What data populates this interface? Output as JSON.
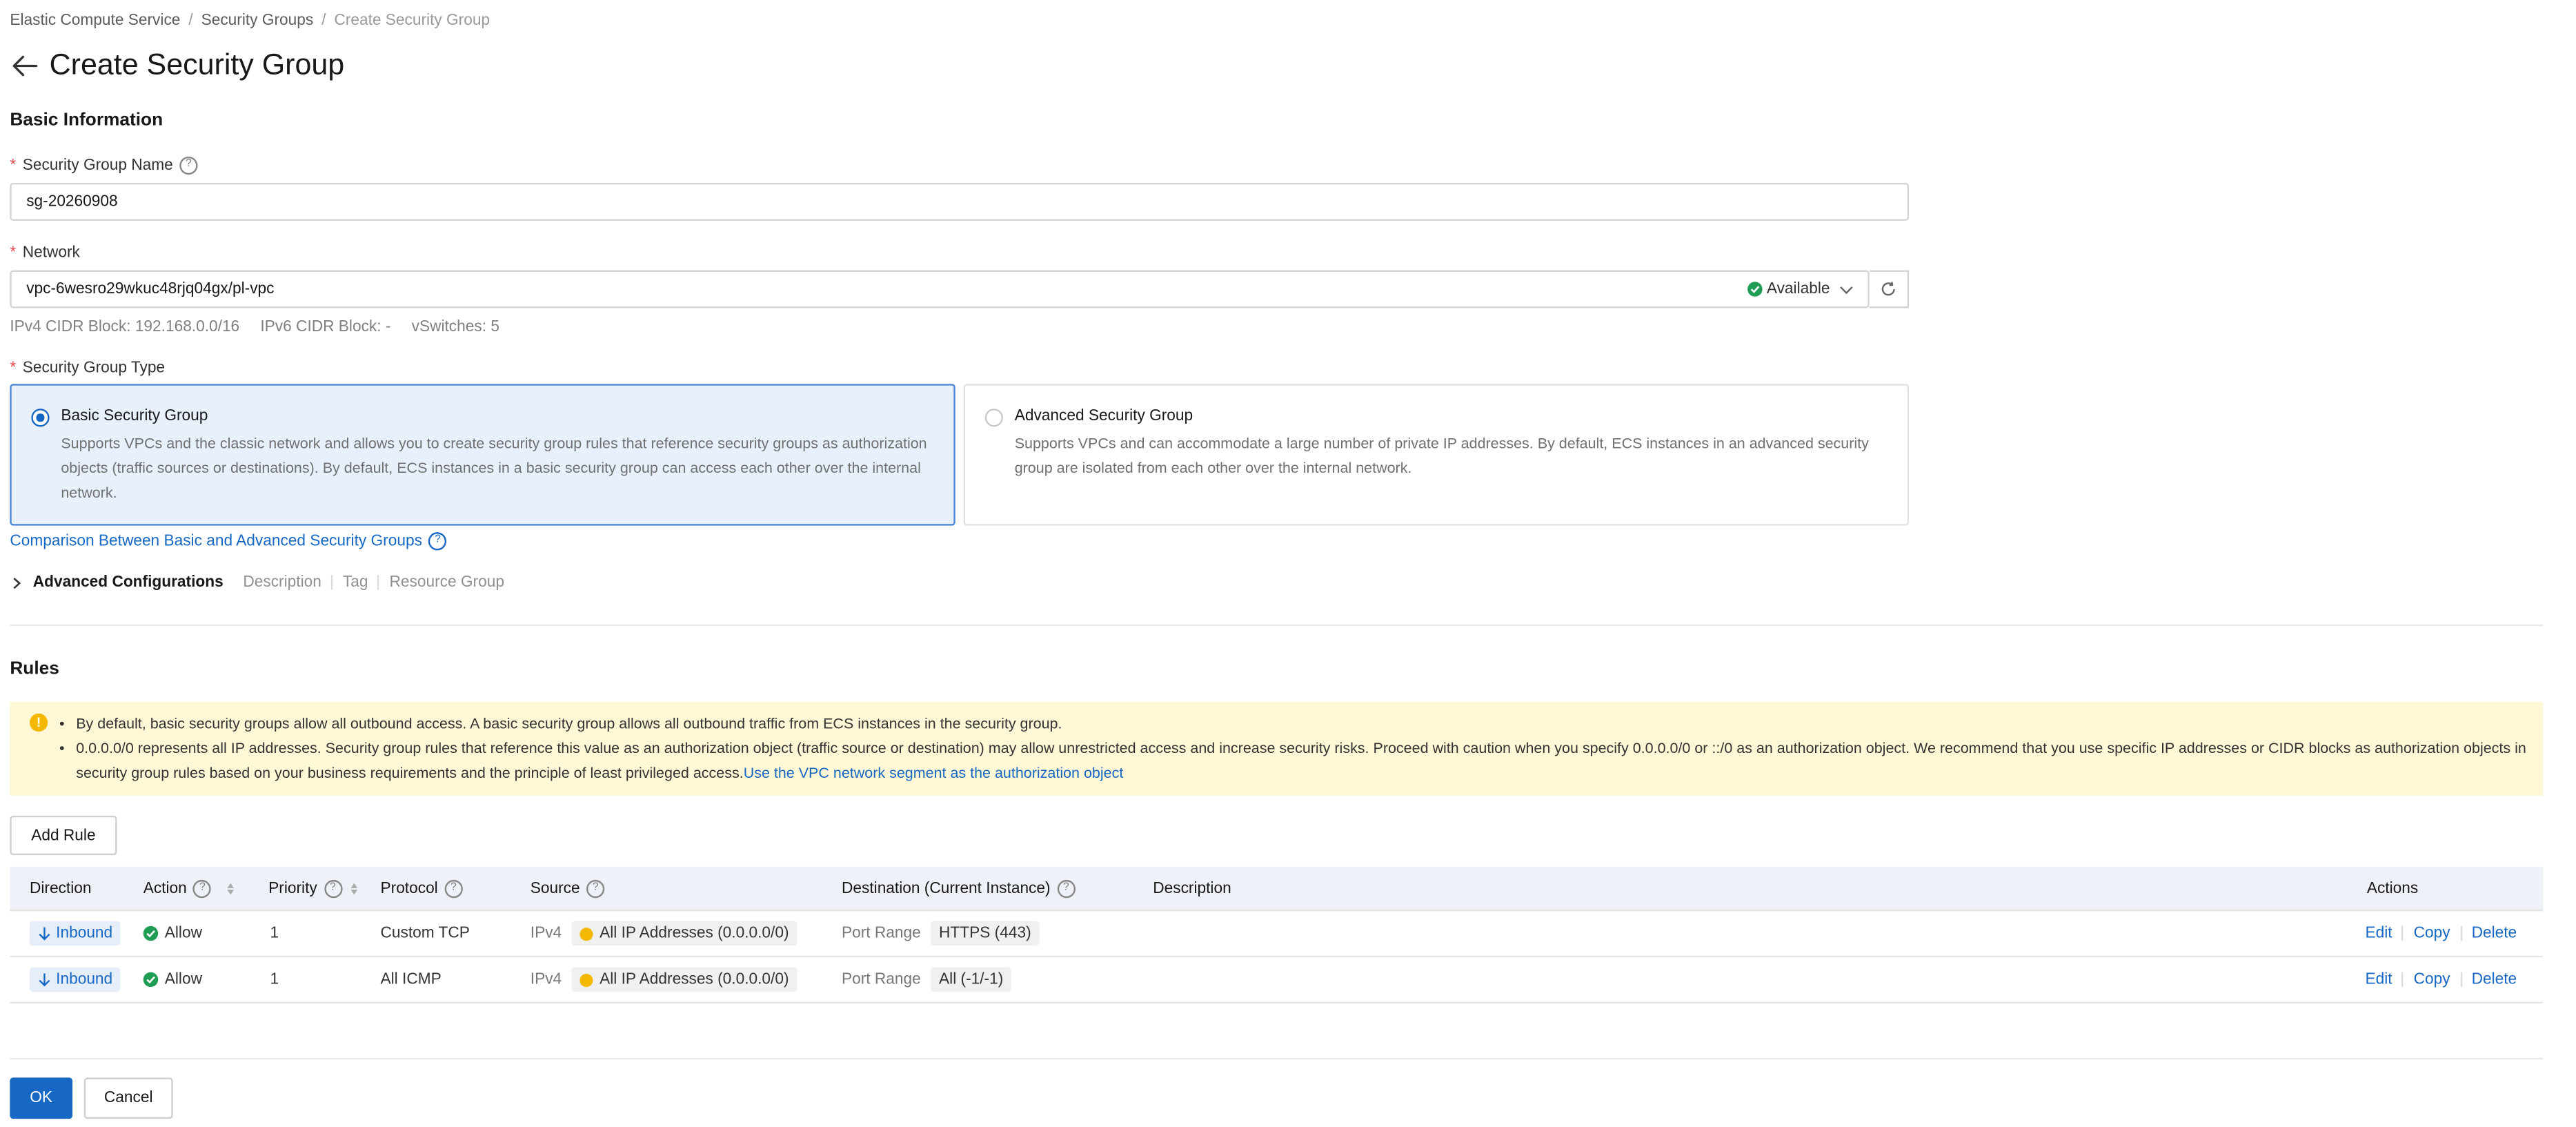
{
  "breadcrumb": {
    "items": [
      "Elastic Compute Service",
      "Security Groups"
    ],
    "separator": "/",
    "current": "Create Security Group"
  },
  "page": {
    "title": "Create Security Group"
  },
  "basic_info": {
    "title": "Basic Information",
    "name_label": "Security Group Name",
    "name_value": "sg-20260908",
    "network_label": "Network",
    "network_value": "vpc-6wesro29wkuc48rjq04gx/pl-vpc",
    "network_status": "Available",
    "ipv4": "IPv4 CIDR Block: 192.168.0.0/16",
    "ipv6": "IPv6 CIDR Block: -",
    "vswitches": "vSwitches: 5",
    "type_label": "Security Group Type",
    "types": [
      {
        "title": "Basic Security Group",
        "desc": "Supports VPCs and the classic network and allows you to create security group rules that reference security groups as authorization objects (traffic sources or destinations). By default, ECS instances in a basic security group can access each other over the internal network.",
        "selected": true
      },
      {
        "title": "Advanced Security Group",
        "desc": "Supports VPCs and can accommodate a large number of private IP addresses. By default, ECS instances in an advanced security group are isolated from each other over the internal network.",
        "selected": false
      }
    ],
    "comparison_link": "Comparison Between Basic and Advanced Security Groups"
  },
  "advanced": {
    "title": "Advanced Configurations",
    "items": [
      "Description",
      "Tag",
      "Resource Group"
    ]
  },
  "rules": {
    "title": "Rules",
    "alert": {
      "bullet1": "By default, basic security groups allow all outbound access. A basic security group allows all outbound traffic from ECS instances in the security group.",
      "bullet2": "0.0.0.0/0 represents all IP addresses. Security group rules that reference this value as an authorization object (traffic source or destination) may allow unrestricted access and increase security risks. Proceed with caution when you specify 0.0.0.0/0 or ::/0 as an authorization object. We recommend that you use specific IP addresses or CIDR blocks as authorization objects in security group rules based on your business requirements and the principle of least privileged access.",
      "link": "Use the VPC network segment as the authorization object"
    },
    "add_button": "Add Rule",
    "columns": {
      "direction": "Direction",
      "action": "Action",
      "priority": "Priority",
      "protocol": "Protocol",
      "source": "Source",
      "destination": "Destination (Current Instance)",
      "description": "Description",
      "actions": "Actions"
    },
    "rows": [
      {
        "direction": "Inbound",
        "action": "Allow",
        "priority": "1",
        "protocol": "Custom TCP",
        "source_type": "IPv4",
        "source": "All IP Addresses (0.0.0.0/0)",
        "dest_label": "Port Range",
        "dest": "HTTPS (443)",
        "description": "",
        "edit": "Edit",
        "copy": "Copy",
        "delete": "Delete"
      },
      {
        "direction": "Inbound",
        "action": "Allow",
        "priority": "1",
        "protocol": "All ICMP",
        "source_type": "IPv4",
        "source": "All IP Addresses (0.0.0.0/0)",
        "dest_label": "Port Range",
        "dest": "All (-1/-1)",
        "description": "",
        "edit": "Edit",
        "copy": "Copy",
        "delete": "Delete"
      }
    ]
  },
  "footer": {
    "ok": "OK",
    "cancel": "Cancel"
  },
  "colors": {
    "primary": "#1768c4",
    "success": "#1f9d55",
    "warning": "#f5b800",
    "required": "#e5484d"
  }
}
